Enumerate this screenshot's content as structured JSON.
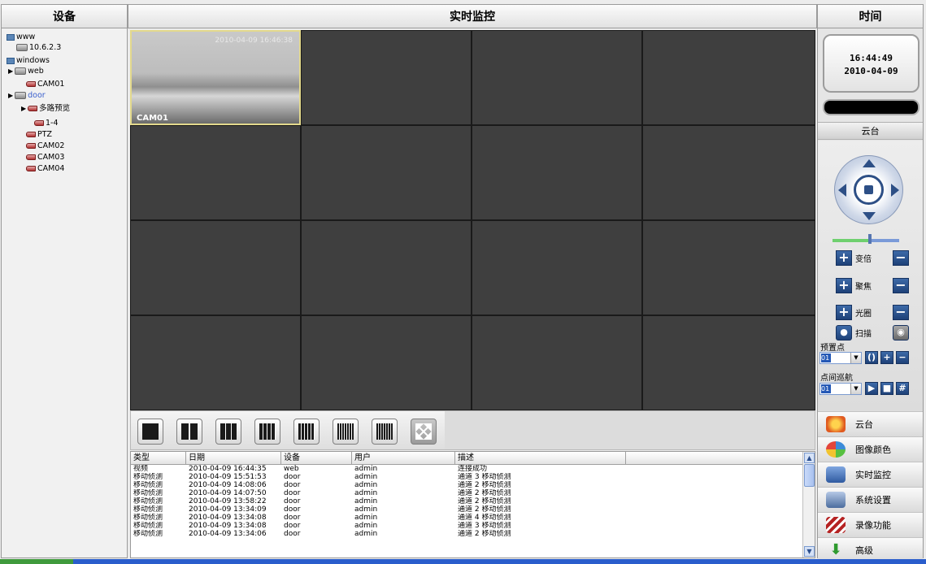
{
  "headers": {
    "devices": "设备",
    "live": "实时监控",
    "time": "时间"
  },
  "tree": [
    {
      "label": "www",
      "icon": "group-icon",
      "level": 0
    },
    {
      "label": "10.6.2.3",
      "icon": "server-icon",
      "level": 1
    },
    {
      "label": "windows",
      "icon": "group-icon",
      "level": 0
    },
    {
      "label": "web",
      "icon": "server-icon",
      "level": 1,
      "expand": "▶"
    },
    {
      "label": "CAM01",
      "icon": "camera-icon",
      "level": 2
    },
    {
      "label": "door",
      "icon": "server-icon",
      "level": 1,
      "expand": "▶",
      "selected": true
    },
    {
      "label": "多路预览",
      "icon": "camera-icon",
      "level": 2,
      "expand": "▶"
    },
    {
      "label": "1-4",
      "icon": "camera-icon",
      "level": 3
    },
    {
      "label": "PTZ",
      "icon": "camera-icon",
      "level": 2
    },
    {
      "label": "CAM02",
      "icon": "camera-icon",
      "level": 2
    },
    {
      "label": "CAM03",
      "icon": "camera-icon",
      "level": 2
    },
    {
      "label": "CAM04",
      "icon": "camera-icon",
      "level": 2
    }
  ],
  "video": {
    "cam_label": "CAM01",
    "cam_timestamp": "2010-04-09 16:46:38"
  },
  "log": {
    "columns": [
      "类型",
      "日期",
      "设备",
      "用户",
      "描述",
      ""
    ],
    "rows": [
      [
        "视频",
        "2010-04-09 16:44:35",
        "web",
        "admin",
        "连接成功"
      ],
      [
        "移动侦测",
        "2010-04-09 15:51:53",
        "door",
        "admin",
        "通道 3 移动侦测"
      ],
      [
        "移动侦测",
        "2010-04-09 14:08:06",
        "door",
        "admin",
        "通道 2 移动侦测"
      ],
      [
        "移动侦测",
        "2010-04-09 14:07:50",
        "door",
        "admin",
        "通道 2 移动侦测"
      ],
      [
        "移动侦测",
        "2010-04-09 13:58:22",
        "door",
        "admin",
        "通道 2 移动侦测"
      ],
      [
        "移动侦测",
        "2010-04-09 13:34:09",
        "door",
        "admin",
        "通道 2 移动侦测"
      ],
      [
        "移动侦测",
        "2010-04-09 13:34:08",
        "door",
        "admin",
        "通道 4 移动侦测"
      ],
      [
        "移动侦测",
        "2010-04-09 13:34:08",
        "door",
        "admin",
        "通道 3 移动侦测"
      ],
      [
        "移动侦测",
        "2010-04-09 13:34:06",
        "door",
        "admin",
        "通道 2 移动侦测"
      ]
    ]
  },
  "clock": {
    "time": "16:44:49",
    "date": "2010-04-09"
  },
  "ptz": {
    "title": "云台",
    "zoom": "变倍",
    "focus": "聚焦",
    "iris": "光圈",
    "scan": "扫描",
    "preset_label": "预置点",
    "preset_value": "01",
    "cruise_label": "点间巡航",
    "cruise_value": "01"
  },
  "menu": [
    "云台",
    "图像颜色",
    "实时监控",
    "系统设置",
    "录像功能",
    "高级"
  ]
}
